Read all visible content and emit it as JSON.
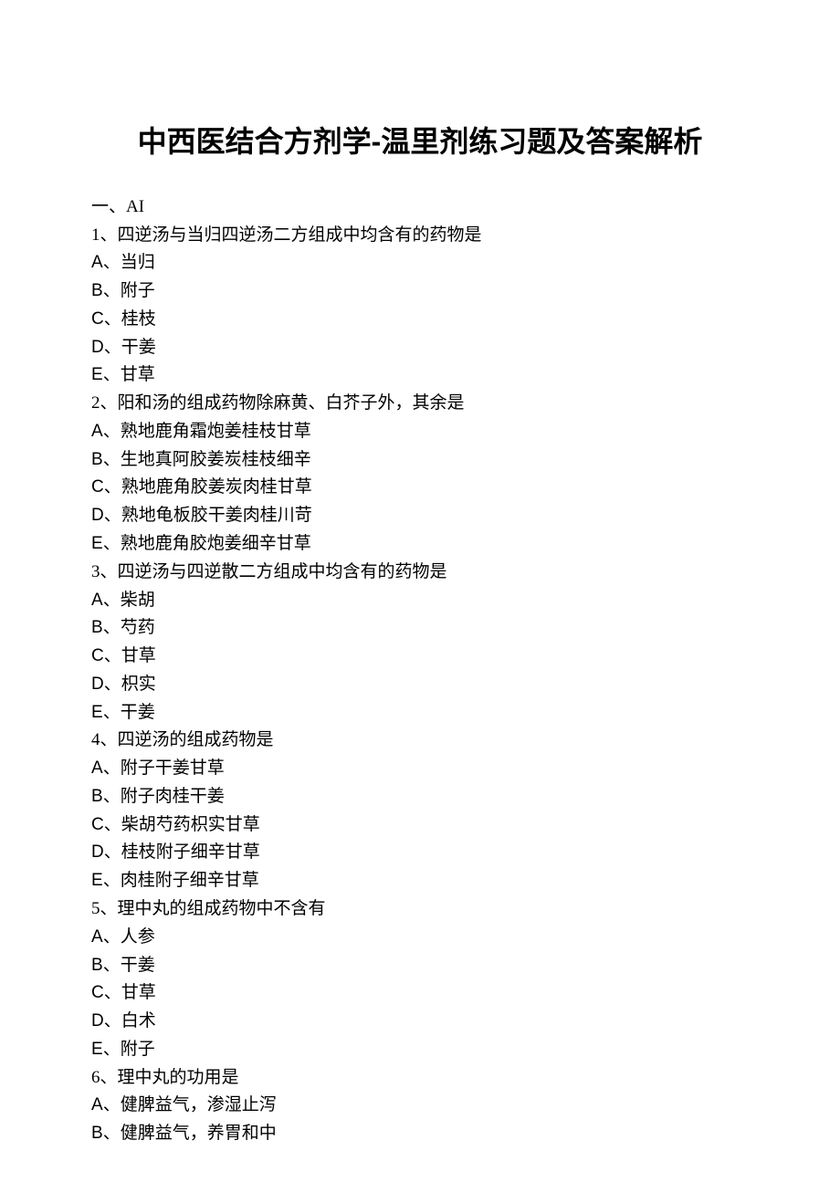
{
  "title": "中西医结合方剂学-温里剂练习题及答案解析",
  "section": "一、AI",
  "questions": [
    {
      "q": "1、四逆汤与当归四逆汤二方组成中均含有的药物是",
      "options": [
        {
          "label": "A",
          "text": "当归"
        },
        {
          "label": "B",
          "text": "附子"
        },
        {
          "label": "C",
          "text": "桂枝"
        },
        {
          "label": "D",
          "text": "干姜"
        },
        {
          "label": "E",
          "text": "甘草"
        }
      ]
    },
    {
      "q": "2、阳和汤的组成药物除麻黄、白芥子外，其余是",
      "options": [
        {
          "label": "A",
          "text": "熟地鹿角霜炮姜桂枝甘草"
        },
        {
          "label": "B",
          "text": "生地真阿胶姜炭桂枝细辛"
        },
        {
          "label": "C",
          "text": "熟地鹿角胶姜炭肉桂甘草"
        },
        {
          "label": "D",
          "text": "熟地龟板胶干姜肉桂川苛"
        },
        {
          "label": "E",
          "text": "熟地鹿角胶炮姜细辛甘草"
        }
      ]
    },
    {
      "q": "3、四逆汤与四逆散二方组成中均含有的药物是",
      "options": [
        {
          "label": "A",
          "text": "柴胡"
        },
        {
          "label": "B",
          "text": "芍药"
        },
        {
          "label": "C",
          "text": "甘草"
        },
        {
          "label": "D",
          "text": "枳实"
        },
        {
          "label": "E",
          "text": "干姜"
        }
      ]
    },
    {
      "q": "4、四逆汤的组成药物是",
      "options": [
        {
          "label": "A",
          "text": "附子干姜甘草"
        },
        {
          "label": "B",
          "text": "附子肉桂干姜"
        },
        {
          "label": "C",
          "text": "柴胡芍药枳实甘草"
        },
        {
          "label": "D",
          "text": "桂枝附子细辛甘草"
        },
        {
          "label": "E",
          "text": "肉桂附子细辛甘草"
        }
      ]
    },
    {
      "q": "5、理中丸的组成药物中不含有",
      "options": [
        {
          "label": "A",
          "text": "人参"
        },
        {
          "label": "B",
          "text": "干姜"
        },
        {
          "label": "C",
          "text": "甘草"
        },
        {
          "label": "D",
          "text": "白术"
        },
        {
          "label": "E",
          "text": "附子"
        }
      ]
    },
    {
      "q": "6、理中丸的功用是",
      "options": [
        {
          "label": "A",
          "text": "健脾益气，渗湿止泻"
        },
        {
          "label": "B",
          "text": "健脾益气，养胃和中"
        }
      ]
    }
  ]
}
